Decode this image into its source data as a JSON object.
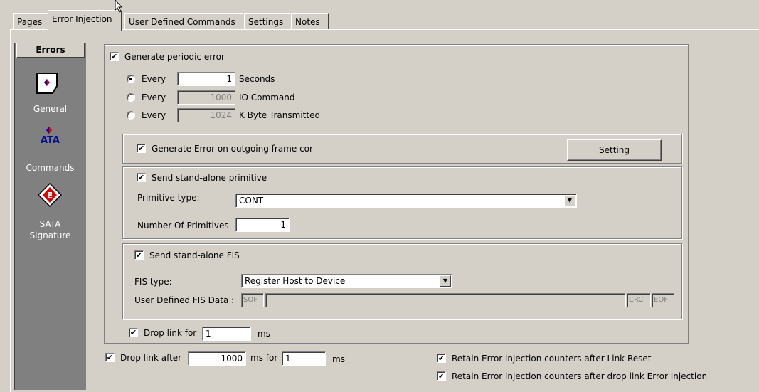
{
  "tabs": [
    {
      "label": "Pages"
    },
    {
      "label": "Error Injection"
    },
    {
      "label": "User Defined Commands"
    },
    {
      "label": "Settings"
    },
    {
      "label": "Notes"
    }
  ],
  "sidebar": {
    "header": "Errors",
    "items": [
      {
        "label": "General",
        "icon": "general-icon"
      },
      {
        "label": "ATA",
        "sublabel": "Commands",
        "icon": "ata-commands-icon"
      },
      {
        "label": "SATA",
        "sublabel": "Signature",
        "icon": "sata-signature-icon"
      }
    ]
  },
  "periodic": {
    "checkbox_label": "Generate periodic error",
    "checked": true,
    "rows": [
      {
        "radio_label": "Every",
        "value": "1",
        "unit": "Seconds",
        "selected": true
      },
      {
        "radio_label": "Every",
        "value": "1000",
        "unit": "IO Command",
        "selected": false
      },
      {
        "radio_label": "Every",
        "value": "1024",
        "unit": "K Byte Transmitted",
        "selected": false
      }
    ]
  },
  "outgoing": {
    "checkbox_label": "Generate Error on outgoing frame cor",
    "button_label": "Setting"
  },
  "primitive": {
    "checkbox_label": "Send stand-alone primitive",
    "type_label": "Primitive type:",
    "type_value": "CONT",
    "count_label": "Number Of Primitives",
    "count_value": "1"
  },
  "fis": {
    "checkbox_label": "Send stand-alone FIS",
    "type_label": "FIS type:",
    "type_value": "Register Host to Device",
    "user_data_label": "User Defined FIS Data :",
    "sof": "SOF",
    "crc": "CRC",
    "eof": "EOF"
  },
  "drop_link": {
    "label": "Drop link for",
    "value": "1",
    "unit": "ms"
  },
  "drop_link_after": {
    "label": "Drop link after",
    "after_value": "1000",
    "mid_label": "ms for",
    "for_value": "1",
    "unit": "ms"
  },
  "retain": {
    "reset_label": "Retain Error injection counters after Link Reset",
    "drop_label": "Retain Error injection counters after drop link Error Injection"
  },
  "checkmark": "✔"
}
